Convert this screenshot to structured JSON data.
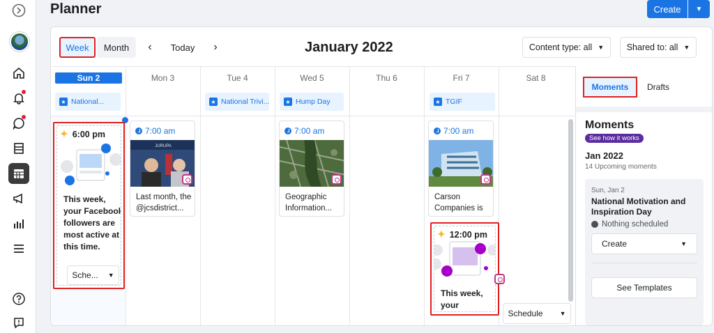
{
  "page": {
    "title": "Planner"
  },
  "header": {
    "create_label": "Create"
  },
  "toolbar": {
    "week_label": "Week",
    "month_label": "Month",
    "prev_label": "‹",
    "today_label": "Today",
    "next_label": "›",
    "month_title": "January 2022",
    "content_type_label": "Content type: all",
    "shared_to_label": "Shared to: all"
  },
  "days": [
    {
      "label": "Sun 2",
      "selected": true
    },
    {
      "label": "Mon 3"
    },
    {
      "label": "Tue 4"
    },
    {
      "label": "Wed 5"
    },
    {
      "label": "Thu 6"
    },
    {
      "label": "Fri 7"
    },
    {
      "label": "Sat 8"
    }
  ],
  "moments_chips": [
    "National...",
    "National Trivi...",
    "Hump Day",
    "TGIF"
  ],
  "best_times": [
    {
      "time": "6:00 pm",
      "text": "This week, your Facebook followers are most active at this time.",
      "schedule_label": "Sche..."
    },
    {
      "time": "12:00 pm",
      "text": "This week, your Instagram foll..."
    }
  ],
  "posts": [
    {
      "time": "7:00 am",
      "caption": "Last month, the @jcsdistrict...",
      "image_text": "JURUPA"
    },
    {
      "time": "7:00 am",
      "caption": "Geographic Information..."
    },
    {
      "time": "7:00 am",
      "caption": "Carson Companies is ..."
    }
  ],
  "schedule_label": "Schedule",
  "right_panel": {
    "tab_moments": "Moments",
    "tab_drafts": "Drafts",
    "heading": "Moments",
    "see_how": "See how it works",
    "month": "Jan 2022",
    "upcoming": "14 Upcoming moments",
    "moment": {
      "date": "Sun, Jan 2",
      "title": "National Motivation and Inspiration Day",
      "status": "Nothing scheduled",
      "create_label": "Create",
      "templates_label": "See Templates"
    }
  },
  "colors": {
    "accent": "#1b74e4",
    "highlight": "#e02020",
    "instagram": "#c13584"
  }
}
